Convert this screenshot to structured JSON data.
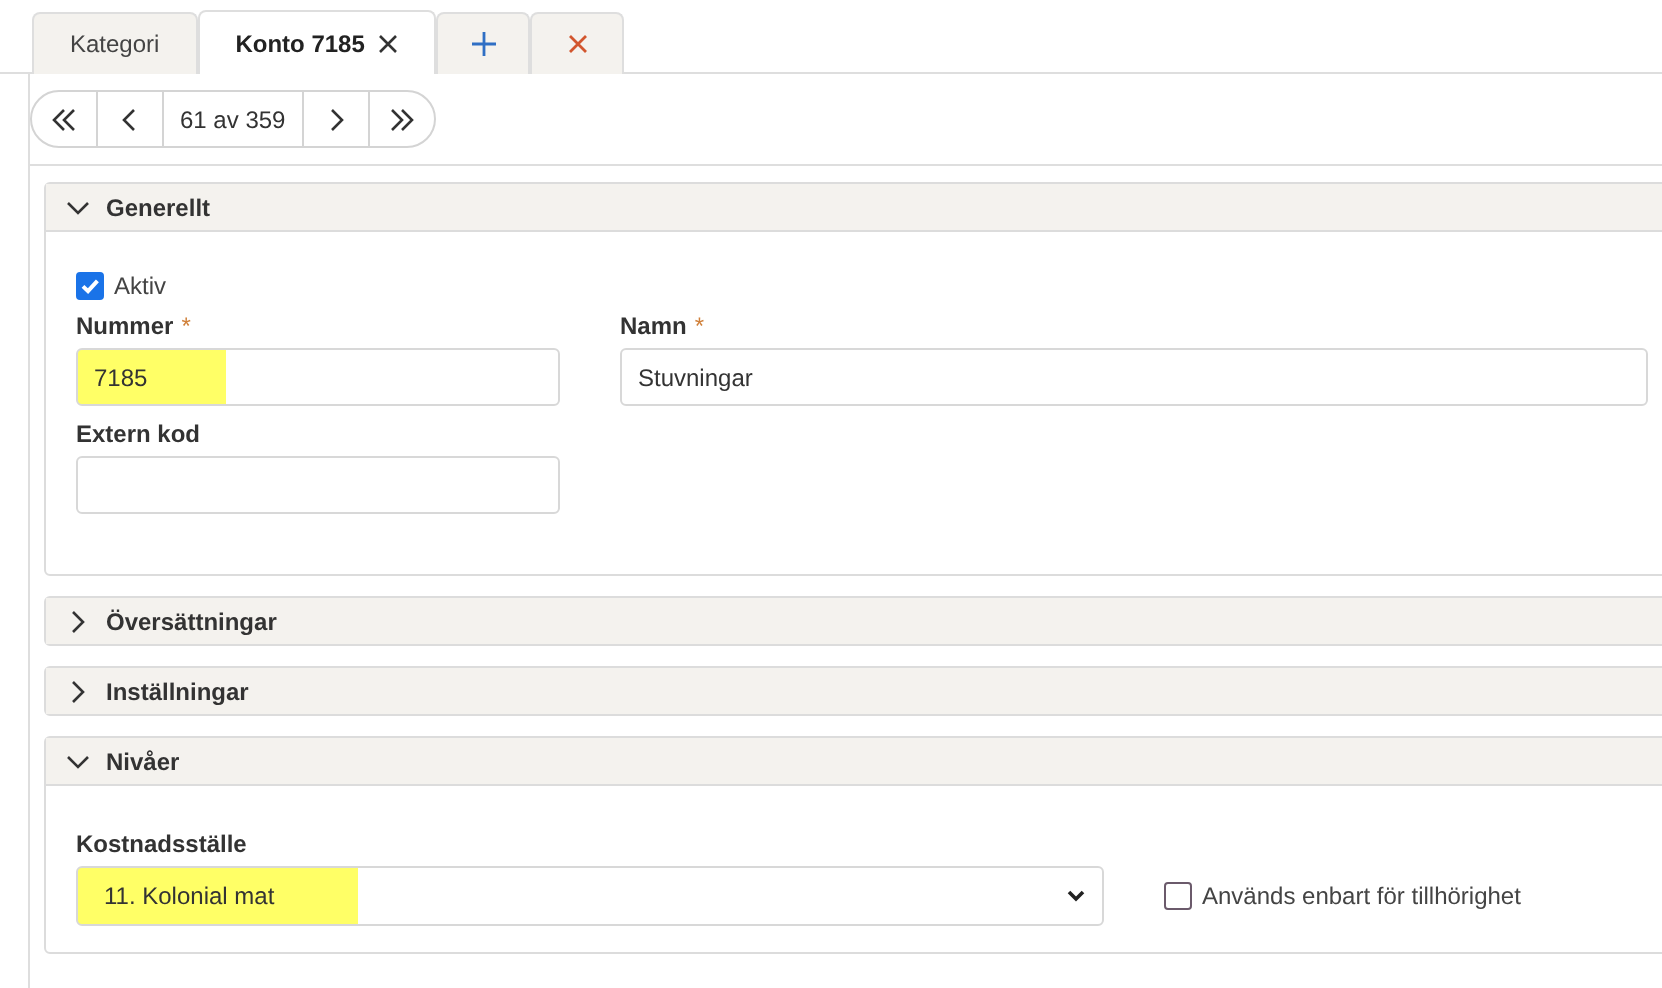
{
  "tabs": [
    {
      "kind": "text",
      "label": "Kategori",
      "selected": false,
      "closable": false
    },
    {
      "kind": "text",
      "label": "Konto 7185",
      "selected": true,
      "closable": true
    },
    {
      "kind": "add",
      "selected": false
    },
    {
      "kind": "close",
      "selected": false
    }
  ],
  "pager": {
    "position": "61 av 359"
  },
  "sections": [
    {
      "kind": "general",
      "title": "Generellt",
      "expanded": true,
      "checkbox": {
        "label": "Aktiv",
        "checked": true
      },
      "fields": [
        {
          "label": "Nummer",
          "required_mark": "*",
          "value": "7185",
          "highlighted": true
        },
        {
          "label": "Namn",
          "required_mark": "*",
          "value": "Stuvningar",
          "highlighted": false
        },
        {
          "label": "Extern kod",
          "highlighted": false
        }
      ]
    },
    {
      "title": "Översättningar",
      "expanded": false
    },
    {
      "title": "Inställningar",
      "expanded": false
    },
    {
      "kind": "levels",
      "title": "Nivåer",
      "expanded": true,
      "select": {
        "label": "Kostnadsställe",
        "value": "11. Kolonial mat",
        "highlighted": true
      },
      "checkbox": {
        "label": "Används enbart för tillhörighet",
        "checked": false
      }
    }
  ]
}
